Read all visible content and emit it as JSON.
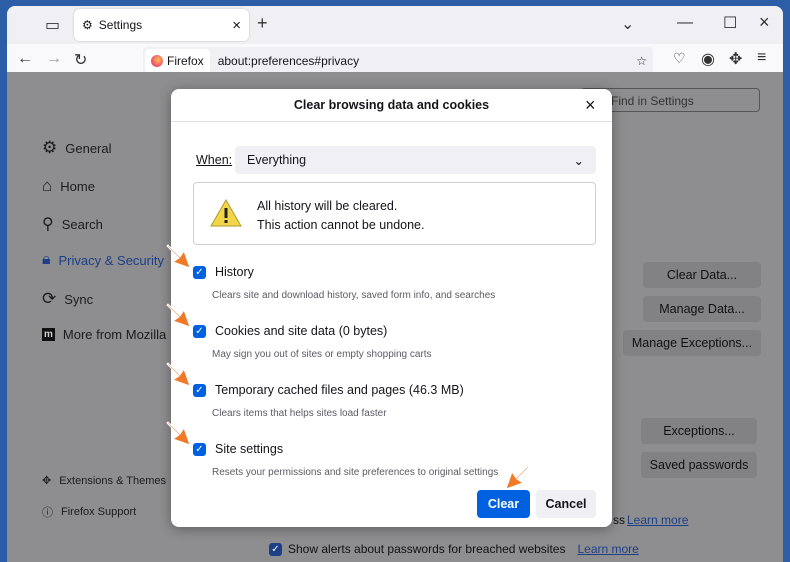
{
  "browser": {
    "tab_title": "Settings",
    "identity_label": "Firefox",
    "url": "about:preferences#privacy"
  },
  "settings": {
    "search_placeholder": "Find in Settings",
    "sidebar": [
      {
        "label": "General",
        "icon": "gear-icon"
      },
      {
        "label": "Home",
        "icon": "home-icon"
      },
      {
        "label": "Search",
        "icon": "search-icon"
      },
      {
        "label": "Privacy & Security",
        "icon": "lock-icon",
        "selected": true
      },
      {
        "label": "Sync",
        "icon": "sync-icon"
      },
      {
        "label": "More from Mozilla",
        "icon": "mozilla-icon"
      }
    ],
    "footer_links": [
      {
        "label": "Extensions & Themes",
        "icon": "puzzle-icon"
      },
      {
        "label": "Firefox Support",
        "icon": "help-icon"
      }
    ],
    "buttons": {
      "clear_data": "Clear Data...",
      "manage_data": "Manage Data...",
      "manage_exceptions": "Manage Exceptions...",
      "exceptions": "Exceptions...",
      "saved_passwords": "Saved passwords"
    },
    "partial_text": "ss",
    "learn_more": "Learn more",
    "breach_alert": "Show alerts about passwords for breached websites",
    "breach_learn_more": "Learn more"
  },
  "dialog": {
    "title": "Clear browsing data and cookies",
    "when_label": "When:",
    "when_value": "Everything",
    "warning_line1": "All history will be cleared.",
    "warning_line2": "This action cannot be undone.",
    "options": [
      {
        "label": "History",
        "desc": "Clears site and download history, saved form info, and searches",
        "checked": true
      },
      {
        "label": "Cookies and site data (0 bytes)",
        "desc": "May sign you out of sites or empty shopping carts",
        "checked": true
      },
      {
        "label": "Temporary cached files and pages (46.3 MB)",
        "desc": "Clears items that helps sites load faster",
        "checked": true
      },
      {
        "label": "Site settings",
        "desc": "Resets your permissions and site preferences to original settings",
        "checked": true
      }
    ],
    "clear_label": "Clear",
    "cancel_label": "Cancel"
  },
  "colors": {
    "accent": "#0061e0",
    "annotation_arrow": "#f07a28"
  }
}
